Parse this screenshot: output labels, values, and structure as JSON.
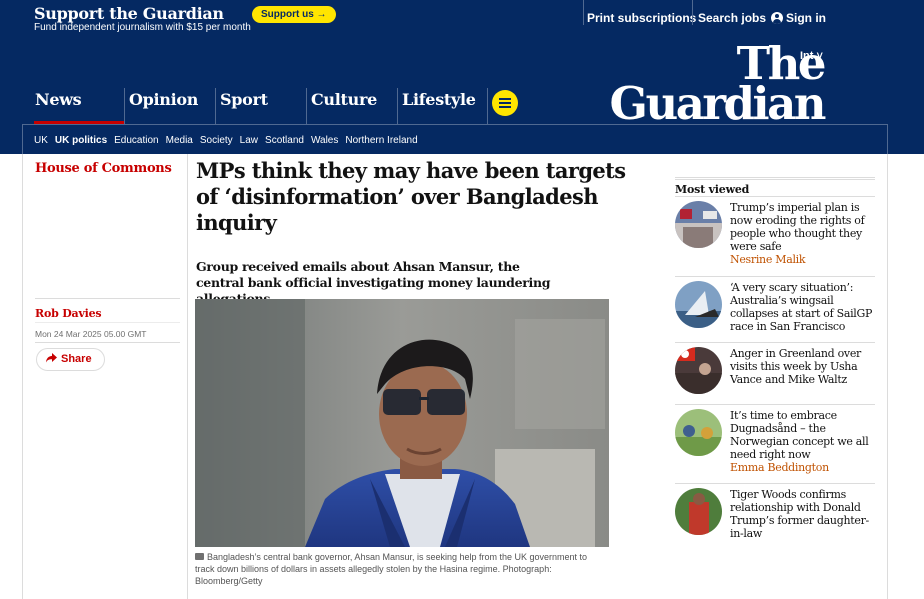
{
  "topbar": {
    "support_title": "Support the Guardian",
    "support_sub": "Fund independent journalism with $15 per month",
    "support_button": "Support us →",
    "print_subscriptions": "Print subscriptions",
    "search_jobs": "Search jobs",
    "sign_in": "Sign in"
  },
  "header": {
    "edition": "Int ˅",
    "logo_line1": "The",
    "logo_line2": "Guardian",
    "pillars": [
      "News",
      "Opinion",
      "Sport",
      "Culture",
      "Lifestyle"
    ],
    "subnav": [
      "UK",
      "UK politics",
      "Education",
      "Media",
      "Society",
      "Law",
      "Scotland",
      "Wales",
      "Northern Ireland"
    ]
  },
  "article": {
    "section": "House of Commons",
    "headline": "MPs think they may have been targets of ‘disinformation’ over Bangladesh inquiry",
    "standfirst": "Group received emails about Ahsan Mansur, the central bank official investigating money laundering allegations",
    "author": "Rob Davies",
    "date": "Mon 24 Mar 2025 05.00 GMT",
    "share_label": "Share",
    "caption": "Bangladesh’s central bank governor, Ahsan Mansur, is seeking help from the UK government to track down billions of dollars in assets allegedly stolen by the Hasina regime. Photograph: Bloomberg/Getty"
  },
  "most_viewed": {
    "title": "Most viewed",
    "items": [
      {
        "headline": "Trump’s imperial plan is now eroding the rights of people who thought they were safe",
        "byline": "Nesrine Malik"
      },
      {
        "headline": "‘A very scary situation’: Australia’s wingsail collapses at start of SailGP race in San Francisco",
        "byline": ""
      },
      {
        "headline": "Anger in Greenland over visits this week by Usha Vance and Mike Waltz",
        "byline": ""
      },
      {
        "headline": "It’s time to embrace Dugnadsånd – the Norwegian concept we all need right now",
        "byline": "Emma Beddington"
      },
      {
        "headline": "Tiger Woods confirms relationship with Donald Trump’s former daughter-in-law",
        "byline": ""
      }
    ]
  },
  "colors": {
    "brand": "#052962",
    "accent_red": "#c70000",
    "support_yellow": "#ffe500",
    "byline_orange": "#c05303"
  }
}
